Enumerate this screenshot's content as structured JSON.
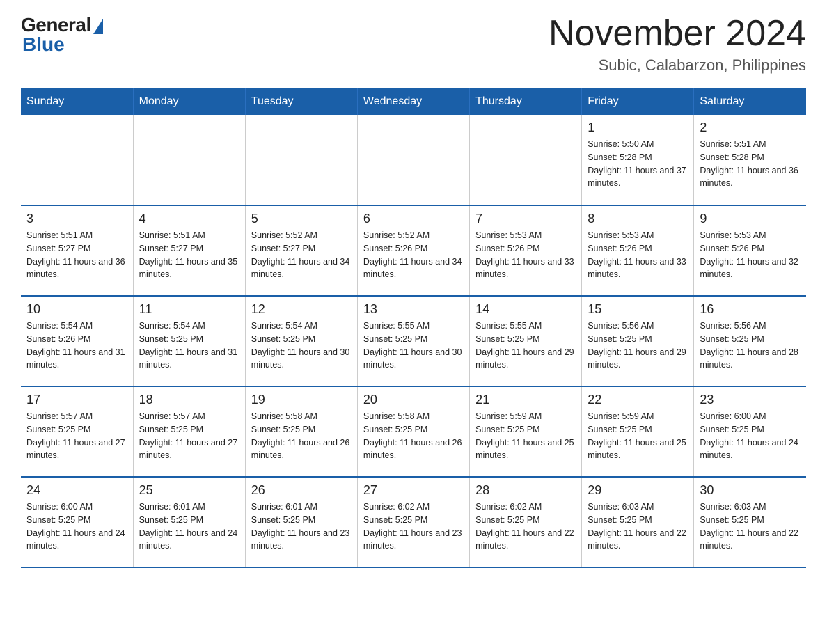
{
  "logo": {
    "general": "General",
    "blue": "Blue"
  },
  "title": "November 2024",
  "subtitle": "Subic, Calabarzon, Philippines",
  "days_of_week": [
    "Sunday",
    "Monday",
    "Tuesday",
    "Wednesday",
    "Thursday",
    "Friday",
    "Saturday"
  ],
  "weeks": [
    [
      {
        "day": "",
        "info": ""
      },
      {
        "day": "",
        "info": ""
      },
      {
        "day": "",
        "info": ""
      },
      {
        "day": "",
        "info": ""
      },
      {
        "day": "",
        "info": ""
      },
      {
        "day": "1",
        "info": "Sunrise: 5:50 AM\nSunset: 5:28 PM\nDaylight: 11 hours and 37 minutes."
      },
      {
        "day": "2",
        "info": "Sunrise: 5:51 AM\nSunset: 5:28 PM\nDaylight: 11 hours and 36 minutes."
      }
    ],
    [
      {
        "day": "3",
        "info": "Sunrise: 5:51 AM\nSunset: 5:27 PM\nDaylight: 11 hours and 36 minutes."
      },
      {
        "day": "4",
        "info": "Sunrise: 5:51 AM\nSunset: 5:27 PM\nDaylight: 11 hours and 35 minutes."
      },
      {
        "day": "5",
        "info": "Sunrise: 5:52 AM\nSunset: 5:27 PM\nDaylight: 11 hours and 34 minutes."
      },
      {
        "day": "6",
        "info": "Sunrise: 5:52 AM\nSunset: 5:26 PM\nDaylight: 11 hours and 34 minutes."
      },
      {
        "day": "7",
        "info": "Sunrise: 5:53 AM\nSunset: 5:26 PM\nDaylight: 11 hours and 33 minutes."
      },
      {
        "day": "8",
        "info": "Sunrise: 5:53 AM\nSunset: 5:26 PM\nDaylight: 11 hours and 33 minutes."
      },
      {
        "day": "9",
        "info": "Sunrise: 5:53 AM\nSunset: 5:26 PM\nDaylight: 11 hours and 32 minutes."
      }
    ],
    [
      {
        "day": "10",
        "info": "Sunrise: 5:54 AM\nSunset: 5:26 PM\nDaylight: 11 hours and 31 minutes."
      },
      {
        "day": "11",
        "info": "Sunrise: 5:54 AM\nSunset: 5:25 PM\nDaylight: 11 hours and 31 minutes."
      },
      {
        "day": "12",
        "info": "Sunrise: 5:54 AM\nSunset: 5:25 PM\nDaylight: 11 hours and 30 minutes."
      },
      {
        "day": "13",
        "info": "Sunrise: 5:55 AM\nSunset: 5:25 PM\nDaylight: 11 hours and 30 minutes."
      },
      {
        "day": "14",
        "info": "Sunrise: 5:55 AM\nSunset: 5:25 PM\nDaylight: 11 hours and 29 minutes."
      },
      {
        "day": "15",
        "info": "Sunrise: 5:56 AM\nSunset: 5:25 PM\nDaylight: 11 hours and 29 minutes."
      },
      {
        "day": "16",
        "info": "Sunrise: 5:56 AM\nSunset: 5:25 PM\nDaylight: 11 hours and 28 minutes."
      }
    ],
    [
      {
        "day": "17",
        "info": "Sunrise: 5:57 AM\nSunset: 5:25 PM\nDaylight: 11 hours and 27 minutes."
      },
      {
        "day": "18",
        "info": "Sunrise: 5:57 AM\nSunset: 5:25 PM\nDaylight: 11 hours and 27 minutes."
      },
      {
        "day": "19",
        "info": "Sunrise: 5:58 AM\nSunset: 5:25 PM\nDaylight: 11 hours and 26 minutes."
      },
      {
        "day": "20",
        "info": "Sunrise: 5:58 AM\nSunset: 5:25 PM\nDaylight: 11 hours and 26 minutes."
      },
      {
        "day": "21",
        "info": "Sunrise: 5:59 AM\nSunset: 5:25 PM\nDaylight: 11 hours and 25 minutes."
      },
      {
        "day": "22",
        "info": "Sunrise: 5:59 AM\nSunset: 5:25 PM\nDaylight: 11 hours and 25 minutes."
      },
      {
        "day": "23",
        "info": "Sunrise: 6:00 AM\nSunset: 5:25 PM\nDaylight: 11 hours and 24 minutes."
      }
    ],
    [
      {
        "day": "24",
        "info": "Sunrise: 6:00 AM\nSunset: 5:25 PM\nDaylight: 11 hours and 24 minutes."
      },
      {
        "day": "25",
        "info": "Sunrise: 6:01 AM\nSunset: 5:25 PM\nDaylight: 11 hours and 24 minutes."
      },
      {
        "day": "26",
        "info": "Sunrise: 6:01 AM\nSunset: 5:25 PM\nDaylight: 11 hours and 23 minutes."
      },
      {
        "day": "27",
        "info": "Sunrise: 6:02 AM\nSunset: 5:25 PM\nDaylight: 11 hours and 23 minutes."
      },
      {
        "day": "28",
        "info": "Sunrise: 6:02 AM\nSunset: 5:25 PM\nDaylight: 11 hours and 22 minutes."
      },
      {
        "day": "29",
        "info": "Sunrise: 6:03 AM\nSunset: 5:25 PM\nDaylight: 11 hours and 22 minutes."
      },
      {
        "day": "30",
        "info": "Sunrise: 6:03 AM\nSunset: 5:25 PM\nDaylight: 11 hours and 22 minutes."
      }
    ]
  ]
}
